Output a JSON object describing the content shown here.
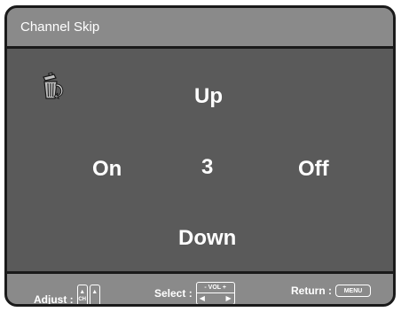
{
  "window": {
    "title": "Channel Skip"
  },
  "icons": {
    "trash": "trash-can-icon"
  },
  "options": {
    "up": "Up",
    "down": "Down",
    "on": "On",
    "off": "Off",
    "channel_number": "3"
  },
  "footer": {
    "adjust_label": "Adjust :",
    "adjust_key": "CH",
    "select_label": "Select :",
    "select_key": "- VOL +",
    "return_label": "Return :",
    "return_key": "MENU"
  },
  "colors": {
    "content_bg": "#5a5a5a",
    "title_bg": "#8a8a8a",
    "border": "#1a1a1a",
    "text": "#ffffff"
  }
}
